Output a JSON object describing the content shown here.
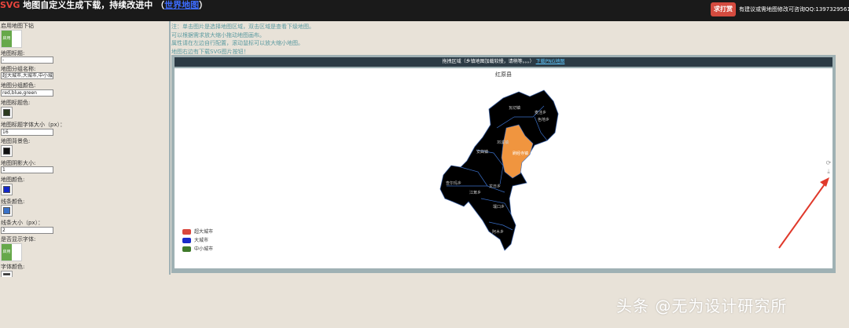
{
  "header": {
    "svg_word": "SVG",
    "title": " 地图自定义生成下载，持续改进中 （",
    "link": "世界地图",
    "title_tail": "）",
    "tip_button": "求打赏",
    "contact": "有建议或需地图修改可咨询QQ:1397329561"
  },
  "left": {
    "drilldown_label": "启用地图下钻",
    "drilldown_toggle": "启用",
    "map_title_label": "地图标题:",
    "map_title_value": "-",
    "group_name_label": "地图分组名称:",
    "group_name_value": "超大城市,大城市,中小城",
    "group_color_label": "地图分组颜色:",
    "group_color_value": "red,blue,green",
    "title_color_label": "地图标题色:",
    "title_color": "#2b3a1f",
    "title_font_label": "地图标题字体大小（px）：",
    "title_font_value": "16",
    "bg_label": "地图背景色:",
    "bg_color": "#111111",
    "shadow_label": "地图阴影大小:",
    "shadow_value": "1",
    "map_color_label": "地图颜色:",
    "map_color": "#1327c9",
    "line_color_label": "线条颜色:",
    "line_color": "#3a72c8",
    "line_size_label": "线条大小（px）：",
    "line_size_value": "2",
    "show_font_label": "是否显示字体:",
    "show_font_toggle": "启用",
    "font_color_label": "字体颜色:",
    "font_color": "#333333"
  },
  "notes": [
    "注：单击图片是选择地图区域，双击区域是查看下级地图。",
    "可以根据需求放大缩小拖动地图画布。",
    "属性请在左边自行配置，滚动鼠标可以放大缩小地图。",
    "地图右边有下载SVG图片按钮！"
  ],
  "map": {
    "header_text": "拖拽区域（乡镇地图加载较慢，请稍等。。。）",
    "header_link": "下载PNG地图",
    "title": "红原县",
    "regions": [
      "瓦切镇",
      "麦洼乡",
      "色地乡",
      "邛溪镇",
      "刷经寺镇",
      "安曲镇",
      "龙日乡",
      "江茸乡",
      "壤口乡",
      "查尔玛乡",
      "阿木乡"
    ],
    "highlight_color": "#f0953f",
    "legend": [
      {
        "label": "超大城市",
        "color": "#d9473d"
      },
      {
        "label": "大城市",
        "color": "#1a2bc9"
      },
      {
        "label": "中小城市",
        "color": "#3f7a2a"
      }
    ]
  },
  "watermark": "头条 @无为设计研究所"
}
